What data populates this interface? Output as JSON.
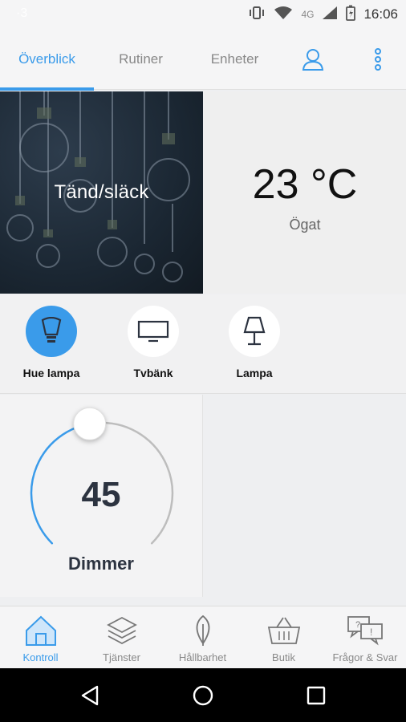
{
  "status_bar": {
    "left_text": "·3",
    "network": "4G",
    "time": "16:06"
  },
  "top_tabs": {
    "tabs": [
      {
        "label": "Överblick",
        "active": true
      },
      {
        "label": "Rutiner",
        "active": false
      },
      {
        "label": "Enheter",
        "active": false
      }
    ],
    "icons": [
      "user-icon",
      "more-vertical-icon"
    ]
  },
  "tiles": {
    "light_toggle": {
      "label": "Tänd/släck"
    },
    "temperature": {
      "value": "23 °C",
      "location": "Ögat"
    }
  },
  "devices": [
    {
      "name": "Hue lampa",
      "icon": "bulb-icon",
      "on": true
    },
    {
      "name": "Tvbänk",
      "icon": "tv-icon",
      "on": false
    },
    {
      "name": "Lampa",
      "icon": "lamp-icon",
      "on": false
    }
  ],
  "dimmer": {
    "value": "45",
    "label": "Dimmer",
    "level_percent": 45
  },
  "bottom_nav": {
    "items": [
      {
        "label": "Kontroll",
        "icon": "home-icon",
        "active": true
      },
      {
        "label": "Tjänster",
        "icon": "layers-icon",
        "active": false
      },
      {
        "label": "Hållbarhet",
        "icon": "leaf-icon",
        "active": false
      },
      {
        "label": "Butik",
        "icon": "basket-icon",
        "active": false
      },
      {
        "label": "Frågor & Svar",
        "icon": "chat-question-icon",
        "active": false
      }
    ]
  },
  "colors": {
    "accent": "#3a9bea",
    "text_dark": "#2c3340"
  }
}
